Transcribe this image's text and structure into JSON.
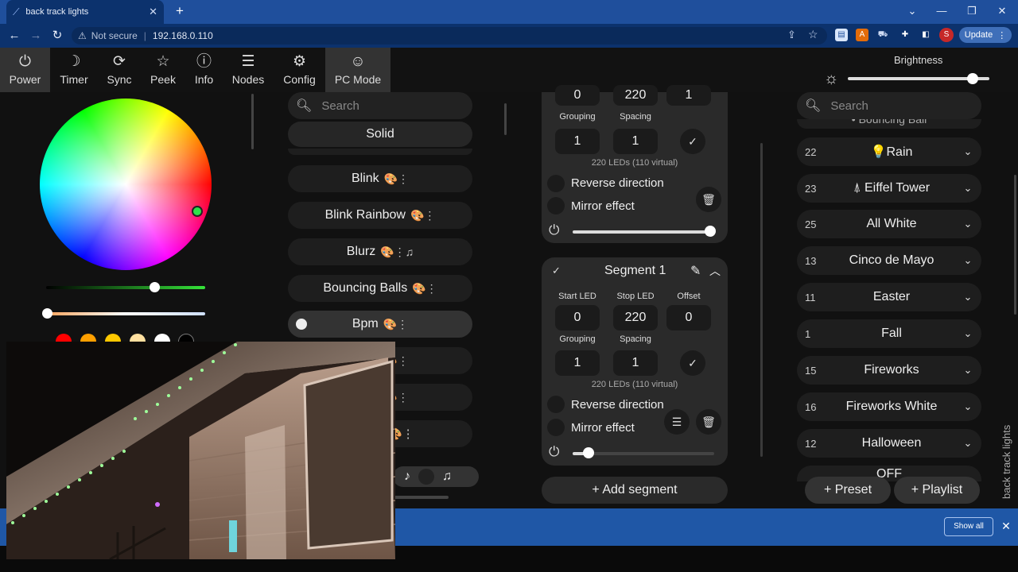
{
  "browser": {
    "tab_title": "back track lights",
    "tab_icon": "wled-icon",
    "not_secure": "Not secure",
    "url": "192.168.0.110",
    "update_label": "Update",
    "avatar_letter": "S"
  },
  "nav": [
    {
      "icon": "power-icon",
      "glyph": "⏻",
      "label": "Power"
    },
    {
      "icon": "moon-icon",
      "glyph": "☽",
      "label": "Timer"
    },
    {
      "icon": "sync-icon",
      "glyph": "⟳",
      "label": "Sync"
    },
    {
      "icon": "star-icon",
      "glyph": "☆",
      "label": "Peek"
    },
    {
      "icon": "info-icon",
      "glyph": "ⓘ",
      "label": "Info"
    },
    {
      "icon": "list-icon",
      "glyph": "☰",
      "label": "Nodes"
    },
    {
      "icon": "gear-icon",
      "glyph": "⚙",
      "label": "Config"
    },
    {
      "icon": "smiley-icon",
      "glyph": "☺",
      "label": "PC Mode"
    }
  ],
  "brightness": {
    "label": "Brightness",
    "level": 0.88
  },
  "color": {
    "swatches": [
      "#ff0000",
      "#ffa000",
      "#ffc800",
      "#ffe0a0",
      "#ffffff",
      "#000000"
    ]
  },
  "effects": {
    "search_placeholder": "Search",
    "items": [
      {
        "name": "Solid",
        "meta": ""
      },
      {
        "name": "Blink",
        "meta": "🎨⋮"
      },
      {
        "name": "Blink Rainbow",
        "meta": "🎨⋮"
      },
      {
        "name": "Blurz",
        "meta": "🎨⋮♫"
      },
      {
        "name": "Bouncing Balls",
        "meta": "🎨⋮"
      },
      {
        "name": "Bpm",
        "meta": "🎨⋮"
      }
    ],
    "partial": [
      "🎨⋮",
      "🎨⋮",
      "ti 🎨⋮",
      "♪",
      "♫"
    ]
  },
  "segment0": {
    "start": "0",
    "stop": "220",
    "offset": "1",
    "grouping_label": "Grouping",
    "spacing_label": "Spacing",
    "grouping": "1",
    "spacing": "1",
    "leds": "220 LEDs (110 virtual)",
    "reverse": "Reverse direction",
    "mirror": "Mirror effect",
    "level": 0.97
  },
  "segment1": {
    "title": "Segment 1",
    "start_label": "Start LED",
    "stop_label": "Stop LED",
    "offset_label": "Offset",
    "start": "0",
    "stop": "220",
    "offset": "0",
    "grouping_label": "Grouping",
    "spacing_label": "Spacing",
    "grouping": "1",
    "spacing": "1",
    "leds": "220 LEDs (110 virtual)",
    "reverse": "Reverse direction",
    "mirror": "Mirror effect",
    "level": 0.11
  },
  "add_segment": "+ Add segment",
  "presets": {
    "search_placeholder": "Search",
    "partial_top": "• Bouncing Ball",
    "items": [
      {
        "id": "22",
        "name": "Rain",
        "icon": "💡"
      },
      {
        "id": "23",
        "name": "Eiffel Tower",
        "icon": "⍋"
      },
      {
        "id": "25",
        "name": "All White",
        "icon": ""
      },
      {
        "id": "13",
        "name": "Cinco de Mayo",
        "icon": ""
      },
      {
        "id": "11",
        "name": "Easter",
        "icon": ""
      },
      {
        "id": "1",
        "name": "Fall",
        "icon": ""
      },
      {
        "id": "15",
        "name": "Fireworks",
        "icon": ""
      },
      {
        "id": "16",
        "name": "Fireworks White",
        "icon": ""
      },
      {
        "id": "12",
        "name": "Halloween",
        "icon": ""
      }
    ],
    "partial_bottom": "OFF",
    "add_preset": "+ Preset",
    "add_playlist": "+ Playlist"
  },
  "side_title": "back track lights",
  "download_bar": {
    "show_all": "Show all"
  }
}
